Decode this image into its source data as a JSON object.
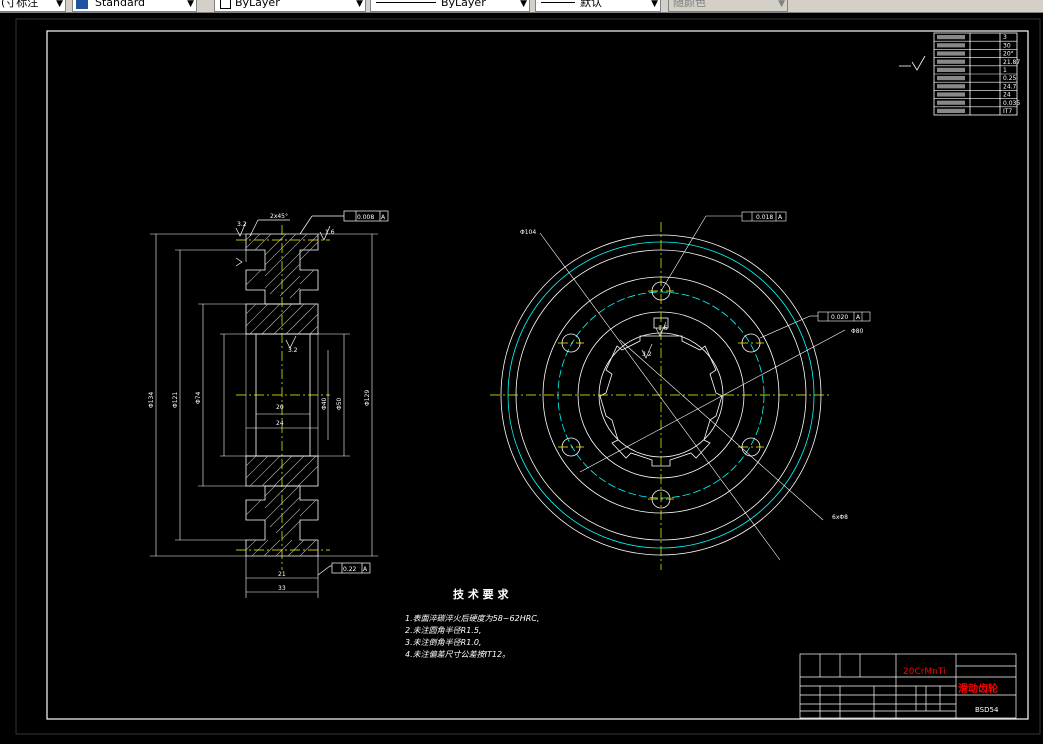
{
  "toolbar": {
    "dimstyle": "(寸标注",
    "textstyle": "Standard",
    "layer_color": "ByLayer",
    "linetype": "ByLayer",
    "lineweight": "默认",
    "plotstyle": "随颜色"
  },
  "drawing": {
    "tech_title": "技 术 要 求",
    "notes": [
      "1.表面淬碳淬火后硬度为58~62HRC,",
      "2.未注圆角半径R1.5,",
      "3.未注倒角半径R1.0,",
      "4.未注偏差尺寸公差按IT12。"
    ],
    "gear_table_vals": [
      "3",
      "30",
      "20°",
      "21.87",
      "1",
      "0.25",
      "24.7",
      "24",
      "0.035",
      "IT7"
    ],
    "material": "20CrMnTi",
    "part_name": "滑动齿轮",
    "drawing_no": "BSD54",
    "tol_left_top": "0.008",
    "tol_left_bottom": "0.22",
    "tol_right_top": "0.018",
    "tol_right_mid": "0.020",
    "dims_left": {
      "chamfer": "2x45°",
      "d_outer": "Φ134",
      "d_mid": "Φ121",
      "d_inner": "Φ74",
      "w_20": "20",
      "w_24": "24",
      "w_21": "21",
      "w_33": "33",
      "d_40": "Φ40",
      "d_50": "Φ50",
      "d_129": "Φ129",
      "r16": "1.6",
      "r32": "3.2"
    },
    "dims_right": {
      "d_outer": "Φ104",
      "d_bolt": "Φ80",
      "holes": "6xΦ8",
      "r32": "3.2",
      "r16": "1.6"
    }
  }
}
